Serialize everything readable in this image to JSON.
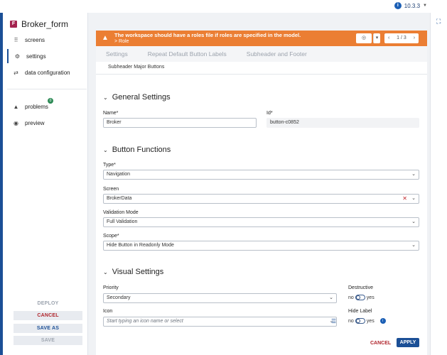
{
  "topbar": {
    "version": "10.3.3"
  },
  "app": {
    "title": "Broker_form",
    "badge": "F"
  },
  "nav": {
    "items": [
      {
        "label": "screens"
      },
      {
        "label": "settings"
      },
      {
        "label": "data configuration"
      },
      {
        "label": "problems",
        "count": "0"
      },
      {
        "label": "preview"
      }
    ]
  },
  "side_actions": {
    "deploy": "DEPLOY",
    "cancel": "CANCEL",
    "save_as": "SAVE AS",
    "save": "SAVE"
  },
  "banner": {
    "message": "The workspace should have a roles file if roles are specified in the model.",
    "sub": "> Role",
    "pager": "1 / 3"
  },
  "tabs": [
    "Settings",
    "Repeat Default Button Labels",
    "Subheader and Footer"
  ],
  "subheader": "Subheader Major Buttons",
  "general": {
    "title": "General Settings",
    "name_label": "Name*",
    "name_value": "Broker",
    "id_label": "Id*",
    "id_value": "button-c0852"
  },
  "functions": {
    "title": "Button Functions",
    "type_label": "Type*",
    "type_value": "Navigation",
    "screen_label": "Screen",
    "screen_value": "BrokerData",
    "validation_label": "Validation Mode",
    "validation_value": "Full Validation",
    "scope_label": "Scope*",
    "scope_value": "Hide Button in Readonly Mode"
  },
  "visual": {
    "title": "Visual Settings",
    "priority_label": "Priority",
    "priority_value": "Secondary",
    "icon_label": "Icon",
    "icon_placeholder": "Start typing an icon name or select",
    "destructive_label": "Destructive",
    "hide_label": "Hide Label",
    "no": "no",
    "yes": "yes"
  },
  "footer": {
    "cancel": "CANCEL",
    "apply": "APPLY"
  },
  "colors": {
    "accent": "#1b4f96",
    "warning": "#eb7e33",
    "danger": "#b0252c"
  }
}
